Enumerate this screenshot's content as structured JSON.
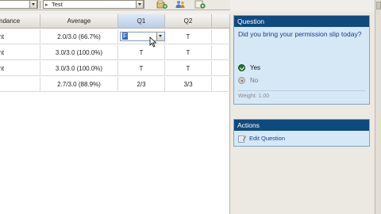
{
  "toolbar": {
    "select1_value": "",
    "select2_value": "Test",
    "icons": [
      "add-grade-icon",
      "users-icon",
      "add-item-icon"
    ]
  },
  "grid": {
    "headers": {
      "attendance": "ndance",
      "average": "Average",
      "q1": "Q1",
      "q2": "Q2"
    },
    "rows": [
      {
        "attendance": "ent",
        "average": "2.0/3.0 (66.7%)",
        "q1": "F",
        "q2": "T",
        "q1_editing": true
      },
      {
        "attendance": "ent",
        "average": "3.0/3.0 (100.0%)",
        "q1": "T",
        "q2": "T"
      },
      {
        "attendance": "ent",
        "average": "3.0/3.0 (100.0%)",
        "q1": "T",
        "q2": "T"
      },
      {
        "attendance": "",
        "average": "2.7/3.0 (88.9%)",
        "q1": "2/3",
        "q2": "3/3"
      }
    ]
  },
  "question_panel": {
    "title": "Question",
    "text": "Did you bring your permission slip today?",
    "options": [
      {
        "label": "Yes",
        "state": "correct"
      },
      {
        "label": "No",
        "state": "not-selected"
      }
    ],
    "weight": "Weight: 1.00"
  },
  "actions_panel": {
    "title": "Actions",
    "links": [
      {
        "label": "Edit Question"
      }
    ]
  },
  "colors": {
    "panel_title_bg": "#0f4a7e",
    "panel_bg": "#d6e8f6",
    "correct_green": "#1c7c2a",
    "question_header": "#b9cde8"
  }
}
